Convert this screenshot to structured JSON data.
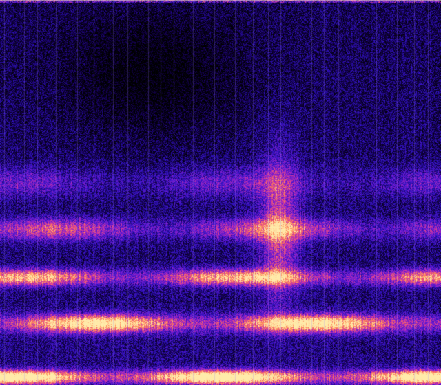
{
  "image": {
    "subject": "spectrogram",
    "colormap": [
      "#000000",
      "#1a0060",
      "#3a10c8",
      "#8a20d0",
      "#e0409a",
      "#ff8a4a",
      "#ffe6a8"
    ],
    "band_count": 5,
    "vertical_stripes": true,
    "top_edge_highlight": true,
    "bottom_edge_highlight": true
  }
}
